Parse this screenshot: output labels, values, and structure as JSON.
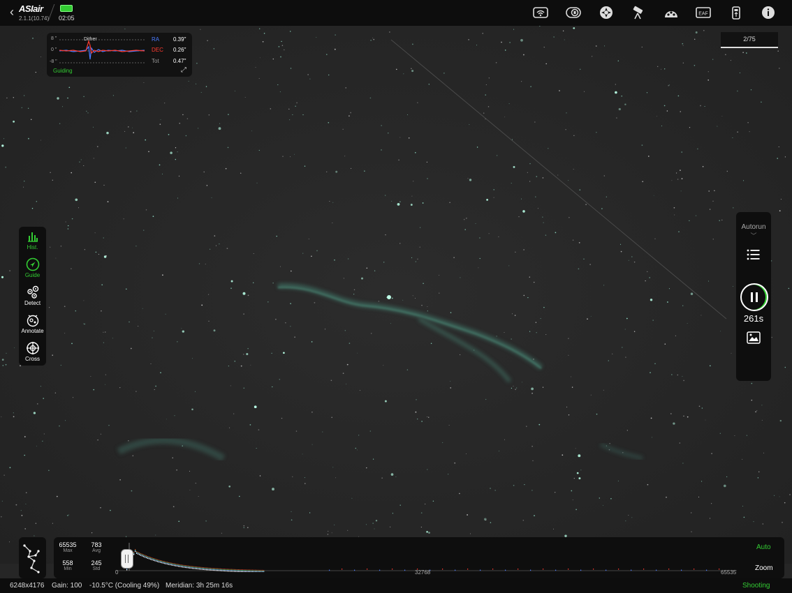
{
  "app": {
    "brand": "ASIair",
    "version": "2.1.1(10.74)",
    "time": "02:05"
  },
  "toolbar_icons": [
    "wifi-icon",
    "camera-icon",
    "mount-icon",
    "telescope-icon",
    "filter-wheel-icon",
    "eaf-icon",
    "usb-icon",
    "info-icon"
  ],
  "guiding": {
    "status": "Guiding",
    "event_label": "Dither",
    "y_top": "8 \"",
    "y_mid": "0 \"",
    "y_bottom": "-8 \"",
    "ra_label": "RA",
    "ra_value": "0.39\"",
    "dec_label": "DEC",
    "dec_value": "0.26\"",
    "tot_label": "Tot",
    "tot_value": "0.47\""
  },
  "frame_counter": "2/75",
  "left_tools": [
    {
      "label": "Hist.",
      "icon": "histogram-icon",
      "active": true
    },
    {
      "label": "Guide",
      "icon": "guide-icon",
      "active": true
    },
    {
      "label": "Detect",
      "icon": "detect-stars-icon",
      "active": false
    },
    {
      "label": "Annotate",
      "icon": "annotate-icon",
      "active": false
    },
    {
      "label": "Cross",
      "icon": "crosshair-icon",
      "active": false
    }
  ],
  "autorun": {
    "title": "Autorun",
    "exposure_remaining": "261s",
    "progress": 0.1
  },
  "histogram": {
    "max_value": "65535",
    "max_label": "Max",
    "avg_value": "783",
    "avg_label": "Avg",
    "min_value": "558",
    "min_label": "Min",
    "std_value": "245",
    "std_label": "Std",
    "axis_start": "0",
    "axis_mid": "32768",
    "axis_end": "65535",
    "auto_label": "Auto",
    "zoom_label": "Zoom"
  },
  "status": {
    "resolution": "6248x4176",
    "gain": "Gain: 100",
    "temperature": "-10.5°C (Cooling 49%)",
    "meridian": "Meridian: 3h 25m 16s",
    "state": "Shooting"
  },
  "colors": {
    "accent_green": "#33cc33",
    "ra_blue": "#4a7bff",
    "dec_red": "#ff3b30"
  }
}
